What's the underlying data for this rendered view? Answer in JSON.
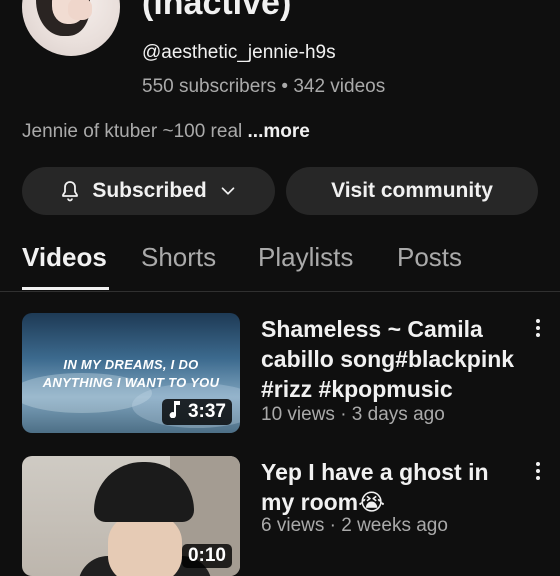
{
  "channel": {
    "title": "(inactive)",
    "handle": "@aesthetic_jennie-h9s",
    "meta": "550 subscribers • 342 videos",
    "description": "Jennie of ktuber ~100 real ",
    "more_label": "...more"
  },
  "actions": {
    "subscribed_label": "Subscribed",
    "community_label": "Visit community"
  },
  "tabs": [
    {
      "label": "Videos",
      "active": true
    },
    {
      "label": "Shorts"
    },
    {
      "label": "Playlists"
    },
    {
      "label": "Posts"
    }
  ],
  "videos": [
    {
      "title": "Shameless ~ Camila cabillo song#blackpink #rizz #kpopmusic",
      "meta": "10 views · 3 days ago",
      "duration": "3:37",
      "thumb_text_line1": "IN MY DREAMS, I DO",
      "thumb_text_line2": "ANYTHING I WANT TO YOU"
    },
    {
      "title": "Yep I have a ghost in my room😭",
      "meta": "6 views · 2 weeks ago",
      "duration": "0:10"
    }
  ]
}
